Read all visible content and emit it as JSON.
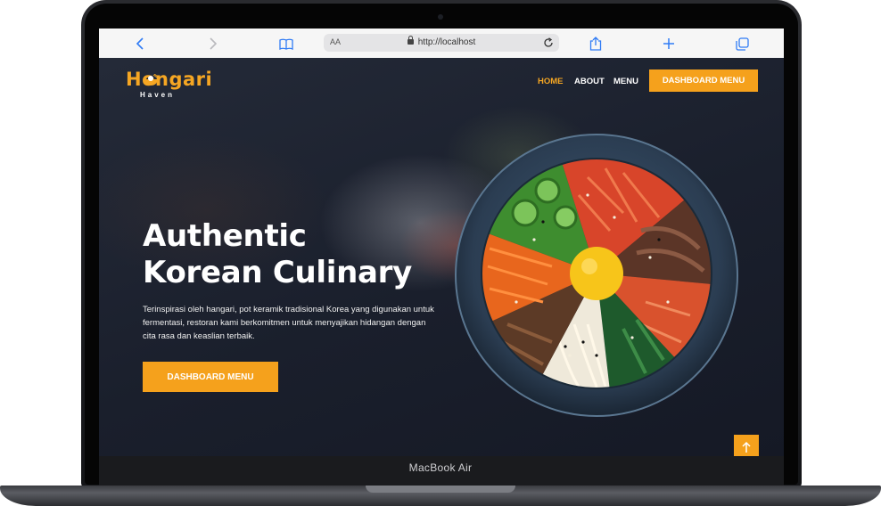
{
  "device": {
    "label": "MacBook Air"
  },
  "browser": {
    "text_size_label": "AA",
    "url": "http://localhost",
    "icons": [
      "back-icon",
      "forward-icon",
      "bookmarks-icon",
      "lock-icon",
      "reload-icon",
      "share-icon",
      "new-tab-icon",
      "tabs-icon"
    ]
  },
  "site": {
    "logo": {
      "main": "Hongari",
      "sub": "Haven"
    },
    "nav": {
      "home": "HOME",
      "about": "ABOUT",
      "menu": "MENU",
      "cta": "DASHBOARD MENU"
    },
    "hero": {
      "title_line1": "Authentic",
      "title_line2": "Korean Culinary",
      "description": "Terinspirasi oleh hangari, pot keramik tradisional Korea yang digunakan untuk fermentasi, restoran kami berkomitmen untuk menyajikan hidangan dengan cita rasa dan keaslian terbaik.",
      "cta": "DASHBOARD MENU"
    }
  },
  "colors": {
    "accent": "#f5a11c",
    "background": "#1b1f2b",
    "text": "#ffffff"
  }
}
